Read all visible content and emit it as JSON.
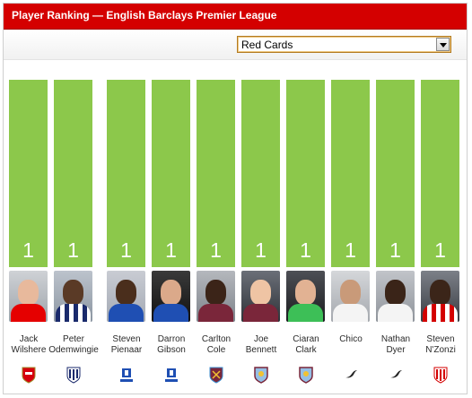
{
  "header": {
    "title": "Player Ranking — English Barclays Premier League"
  },
  "filter": {
    "selected": "Red Cards"
  },
  "colors": {
    "header_bg": "#d40000",
    "bar": "#8cc84b"
  },
  "players": [
    {
      "first": "Jack",
      "last": "Wilshere",
      "value": "1",
      "club": "Arsenal"
    },
    {
      "first": "Peter",
      "last": "Odemwingie",
      "value": "1",
      "club": "West Brom"
    },
    {
      "first": "Steven",
      "last": "Pienaar",
      "value": "1",
      "club": "Everton"
    },
    {
      "first": "Darron",
      "last": "Gibson",
      "value": "1",
      "club": "Everton"
    },
    {
      "first": "Carlton",
      "last": "Cole",
      "value": "1",
      "club": "West Ham"
    },
    {
      "first": "Joe",
      "last": "Bennett",
      "value": "1",
      "club": "Aston Villa"
    },
    {
      "first": "Ciaran",
      "last": "Clark",
      "value": "1",
      "club": "Aston Villa"
    },
    {
      "first": "Chico",
      "last": "",
      "value": "1",
      "club": "Swansea"
    },
    {
      "first": "Nathan",
      "last": "Dyer",
      "value": "1",
      "club": "Swansea"
    },
    {
      "first": "Steven",
      "last": "N'Zonzi",
      "value": "1",
      "club": "Stoke"
    }
  ]
}
